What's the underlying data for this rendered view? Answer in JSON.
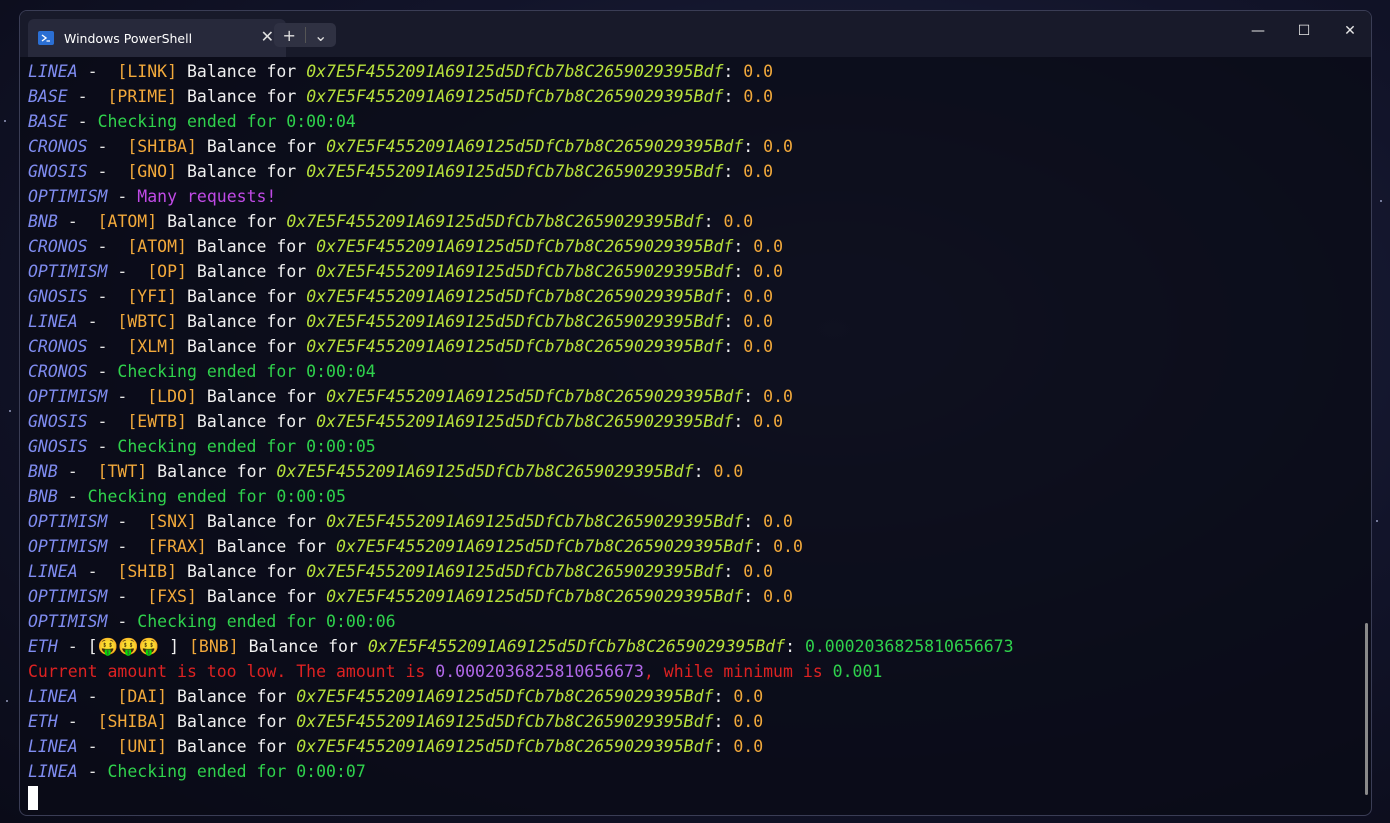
{
  "window": {
    "tab_title": "Windows PowerShell",
    "tab_close": "✕",
    "new_tab": "+",
    "dropdown": "⌄",
    "minimize": "—",
    "maximize": "☐",
    "close": "✕"
  },
  "terminal": {
    "lines": [
      {
        "type": "bal",
        "net": "LINEA",
        "tok": "[LINK]",
        "label": "Balance for",
        "addr": "0x7E5F4552091A69125d5DfCb7b8C2659029395Bdf",
        "val": "0.0"
      },
      {
        "type": "bal",
        "net": "BASE",
        "tok": "[PRIME]",
        "label": "Balance for",
        "addr": "0x7E5F4552091A69125d5DfCb7b8C2659029395Bdf",
        "val": "0.0"
      },
      {
        "type": "end",
        "net": "BASE",
        "text": "Checking ended for 0:00:04"
      },
      {
        "type": "bal",
        "net": "CRONOS",
        "tok": "[SHIBA]",
        "label": "Balance for",
        "addr": "0x7E5F4552091A69125d5DfCb7b8C2659029395Bdf",
        "val": "0.0"
      },
      {
        "type": "bal",
        "net": "GNOSIS",
        "tok": "[GNO]",
        "label": "Balance for",
        "addr": "0x7E5F4552091A69125d5DfCb7b8C2659029395Bdf",
        "val": "0.0"
      },
      {
        "type": "req",
        "net": "OPTIMISM",
        "text": "Many requests!"
      },
      {
        "type": "bal",
        "net": "BNB",
        "tok": "[ATOM]",
        "label": "Balance for",
        "addr": "0x7E5F4552091A69125d5DfCb7b8C2659029395Bdf",
        "val": "0.0"
      },
      {
        "type": "bal",
        "net": "CRONOS",
        "tok": "[ATOM]",
        "label": "Balance for",
        "addr": "0x7E5F4552091A69125d5DfCb7b8C2659029395Bdf",
        "val": "0.0"
      },
      {
        "type": "bal",
        "net": "OPTIMISM",
        "tok": "[OP]",
        "label": "Balance for",
        "addr": "0x7E5F4552091A69125d5DfCb7b8C2659029395Bdf",
        "val": "0.0"
      },
      {
        "type": "bal",
        "net": "GNOSIS",
        "tok": "[YFI]",
        "label": "Balance for",
        "addr": "0x7E5F4552091A69125d5DfCb7b8C2659029395Bdf",
        "val": "0.0"
      },
      {
        "type": "bal",
        "net": "LINEA",
        "tok": "[WBTC]",
        "label": "Balance for",
        "addr": "0x7E5F4552091A69125d5DfCb7b8C2659029395Bdf",
        "val": "0.0"
      },
      {
        "type": "bal",
        "net": "CRONOS",
        "tok": "[XLM]",
        "label": "Balance for",
        "addr": "0x7E5F4552091A69125d5DfCb7b8C2659029395Bdf",
        "val": "0.0"
      },
      {
        "type": "end",
        "net": "CRONOS",
        "text": "Checking ended for 0:00:04"
      },
      {
        "type": "bal",
        "net": "OPTIMISM",
        "tok": "[LDO]",
        "label": "Balance for",
        "addr": "0x7E5F4552091A69125d5DfCb7b8C2659029395Bdf",
        "val": "0.0"
      },
      {
        "type": "bal",
        "net": "GNOSIS",
        "tok": "[EWTB]",
        "label": "Balance for",
        "addr": "0x7E5F4552091A69125d5DfCb7b8C2659029395Bdf",
        "val": "0.0"
      },
      {
        "type": "end",
        "net": "GNOSIS",
        "text": "Checking ended for 0:00:05"
      },
      {
        "type": "bal",
        "net": "BNB",
        "tok": "[TWT]",
        "label": "Balance for",
        "addr": "0x7E5F4552091A69125d5DfCb7b8C2659029395Bdf",
        "val": "0.0"
      },
      {
        "type": "end",
        "net": "BNB",
        "text": "Checking ended for 0:00:05"
      },
      {
        "type": "bal",
        "net": "OPTIMISM",
        "tok": "[SNX]",
        "label": "Balance for",
        "addr": "0x7E5F4552091A69125d5DfCb7b8C2659029395Bdf",
        "val": "0.0"
      },
      {
        "type": "bal",
        "net": "OPTIMISM",
        "tok": "[FRAX]",
        "label": "Balance for",
        "addr": "0x7E5F4552091A69125d5DfCb7b8C2659029395Bdf",
        "val": "0.0"
      },
      {
        "type": "bal",
        "net": "LINEA",
        "tok": "[SHIB]",
        "label": "Balance for",
        "addr": "0x7E5F4552091A69125d5DfCb7b8C2659029395Bdf",
        "val": "0.0"
      },
      {
        "type": "bal",
        "net": "OPTIMISM",
        "tok": "[FXS]",
        "label": "Balance for",
        "addr": "0x7E5F4552091A69125d5DfCb7b8C2659029395Bdf",
        "val": "0.0"
      },
      {
        "type": "end",
        "net": "OPTIMISM",
        "text": "Checking ended for 0:00:06"
      },
      {
        "type": "hit",
        "net": "ETH",
        "emoji": "[🤑🤑🤑 ]",
        "tok": "[BNB]",
        "label": "Balance for",
        "addr": "0x7E5F4552091A69125d5DfCb7b8C2659029395Bdf",
        "val": "0.0002036825810656673"
      },
      {
        "type": "low",
        "pre": "Current amount is too low. The amount is ",
        "amount": "0.0002036825810656673",
        "mid": ", while minimum is ",
        "min": "0.001"
      },
      {
        "type": "bal",
        "net": "LINEA",
        "tok": "[DAI]",
        "label": "Balance for",
        "addr": "0x7E5F4552091A69125d5DfCb7b8C2659029395Bdf",
        "val": "0.0"
      },
      {
        "type": "bal",
        "net": "ETH",
        "tok": "[SHIBA]",
        "label": "Balance for",
        "addr": "0x7E5F4552091A69125d5DfCb7b8C2659029395Bdf",
        "val": "0.0"
      },
      {
        "type": "bal",
        "net": "LINEA",
        "tok": "[UNI]",
        "label": "Balance for",
        "addr": "0x7E5F4552091A69125d5DfCb7b8C2659029395Bdf",
        "val": "0.0"
      },
      {
        "type": "end",
        "net": "LINEA",
        "text": "Checking ended for 0:00:07"
      }
    ]
  },
  "colors": {
    "network": "#7f8cf0",
    "token": "#f2a93b",
    "address": "#b8e23c",
    "success": "#2fd24c",
    "warning": "#c04ae6",
    "error": "#dd2222"
  }
}
